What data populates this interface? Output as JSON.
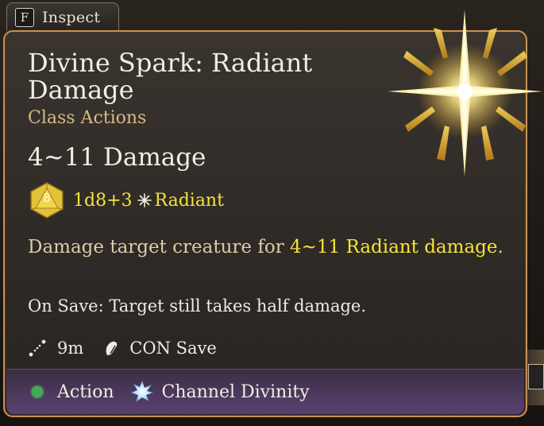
{
  "inspect_tab": {
    "key": "F",
    "label": "Inspect"
  },
  "tooltip": {
    "title": "Divine Spark: Radiant Damage",
    "category": "Class Actions",
    "damage_summary": "4~11 Damage",
    "dice": {
      "die_number": "8",
      "formula": "1d8+3",
      "damage_type": "Radiant"
    },
    "description": {
      "prefix": "Damage target creature for ",
      "highlight": "4~11 Radiant damage",
      "suffix": "."
    },
    "on_save": "On Save: Target still takes half damage.",
    "range": "9m",
    "save": "CON Save",
    "cost_action": "Action",
    "cost_resource": "Channel Divinity"
  },
  "icons": {
    "spell": "radiant-spark-icon",
    "die": "d8-die-icon",
    "damage_type": "radiant-icon",
    "range": "range-icon",
    "save": "saving-throw-icon",
    "action": "action-dot-icon",
    "resource": "channel-divinity-icon"
  },
  "colors": {
    "accent_yellow": "#f5e43a",
    "category": "#d5ba85",
    "border": "#c7904f",
    "action_green": "#3fae4e"
  }
}
